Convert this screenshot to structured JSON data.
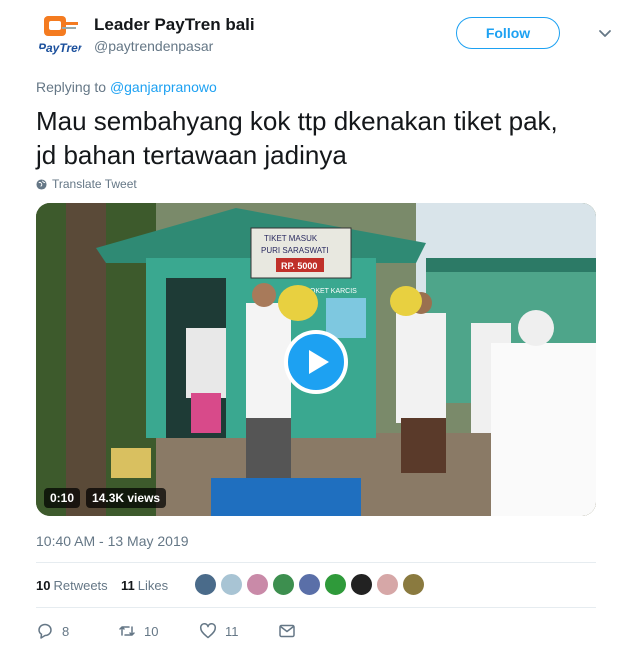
{
  "author": {
    "name": "Leader PayTren bali",
    "handle": "@paytrendenpasar",
    "avatar_logo_text": "PayTren"
  },
  "follow_label": "Follow",
  "reply": {
    "prefix": "Replying to",
    "to": "@ganjarpranowo"
  },
  "tweet_text_line1": "Mau sembahyang kok ttp dkenakan tiket pak,",
  "tweet_text_line2": "jd bahan tertawaan jadinya",
  "translate_label": "Translate Tweet",
  "video": {
    "duration": "0:10",
    "views": "14.3K views",
    "sign_text_1": "TIKET MASUK",
    "sign_text_2": "PURI SARASWATI",
    "price": "RP. 5000",
    "loket": "LOKET KARCIS"
  },
  "timestamp": "10:40 AM - 13 May 2019",
  "stats": {
    "retweets_count": "10",
    "retweets_label": "Retweets",
    "likes_count": "11",
    "likes_label": "Likes"
  },
  "liker_avatar_colors": [
    "#4a6b8a",
    "#a8c4d4",
    "#c98aa8",
    "#3d8f4f",
    "#5a6fa8",
    "#2f9a3a",
    "#222222",
    "#d6a7a7",
    "#8a7a3f"
  ],
  "actions": {
    "reply_count": "8",
    "retweet_count": "10",
    "like_count": "11"
  },
  "colors": {
    "accent": "#1da1f2",
    "secondary_text": "#657786",
    "primary_text": "#14171a"
  }
}
